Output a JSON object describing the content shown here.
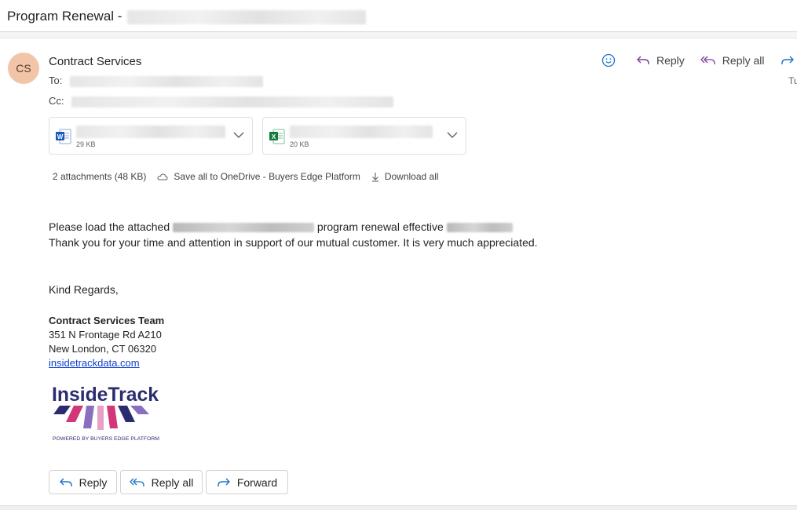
{
  "subject": {
    "prefix": "Program Renewal -"
  },
  "message": {
    "avatar_initials": "CS",
    "sender_name": "Contract Services",
    "to_label": "To:",
    "cc_label": "Cc:",
    "date_partial": "Tu"
  },
  "actions": {
    "emoji_icon": "smiley-icon",
    "reply": "Reply",
    "reply_all": "Reply all",
    "forward_partial": "Fo"
  },
  "attachments": {
    "files": [
      {
        "type": "word",
        "size": "29 KB"
      },
      {
        "type": "excel",
        "size": "20 KB"
      }
    ],
    "summary": "2 attachments (48 KB)",
    "save_all": "Save all to OneDrive - Buyers Edge Platform",
    "download_all": "Download all"
  },
  "body": {
    "line1_before": "Please load the attached",
    "line1_after": "program renewal effective",
    "line2": "Thank you for your time and attention in support of our mutual customer. It is very much appreciated.",
    "closing": "Kind Regards,"
  },
  "signature": {
    "team": "Contract Services Team",
    "address1": "351 N Frontage Rd A210",
    "address2": "New London, CT 06320",
    "website": "insidetrackdata.com",
    "logo_text": "InsideTrack",
    "logo_tagline": "POWERED BY BUYERS EDGE PLATFORM"
  },
  "footer_buttons": {
    "reply": "Reply",
    "reply_all": "Reply all",
    "forward": "Forward"
  },
  "colors": {
    "avatar_bg": "#f3c5a8",
    "reply_accent": "#7a3fa0",
    "forward_accent": "#1a73c9",
    "link": "#0f3fcf",
    "logo_navy": "#2b2c6e",
    "logo_pink": "#d2377a"
  }
}
